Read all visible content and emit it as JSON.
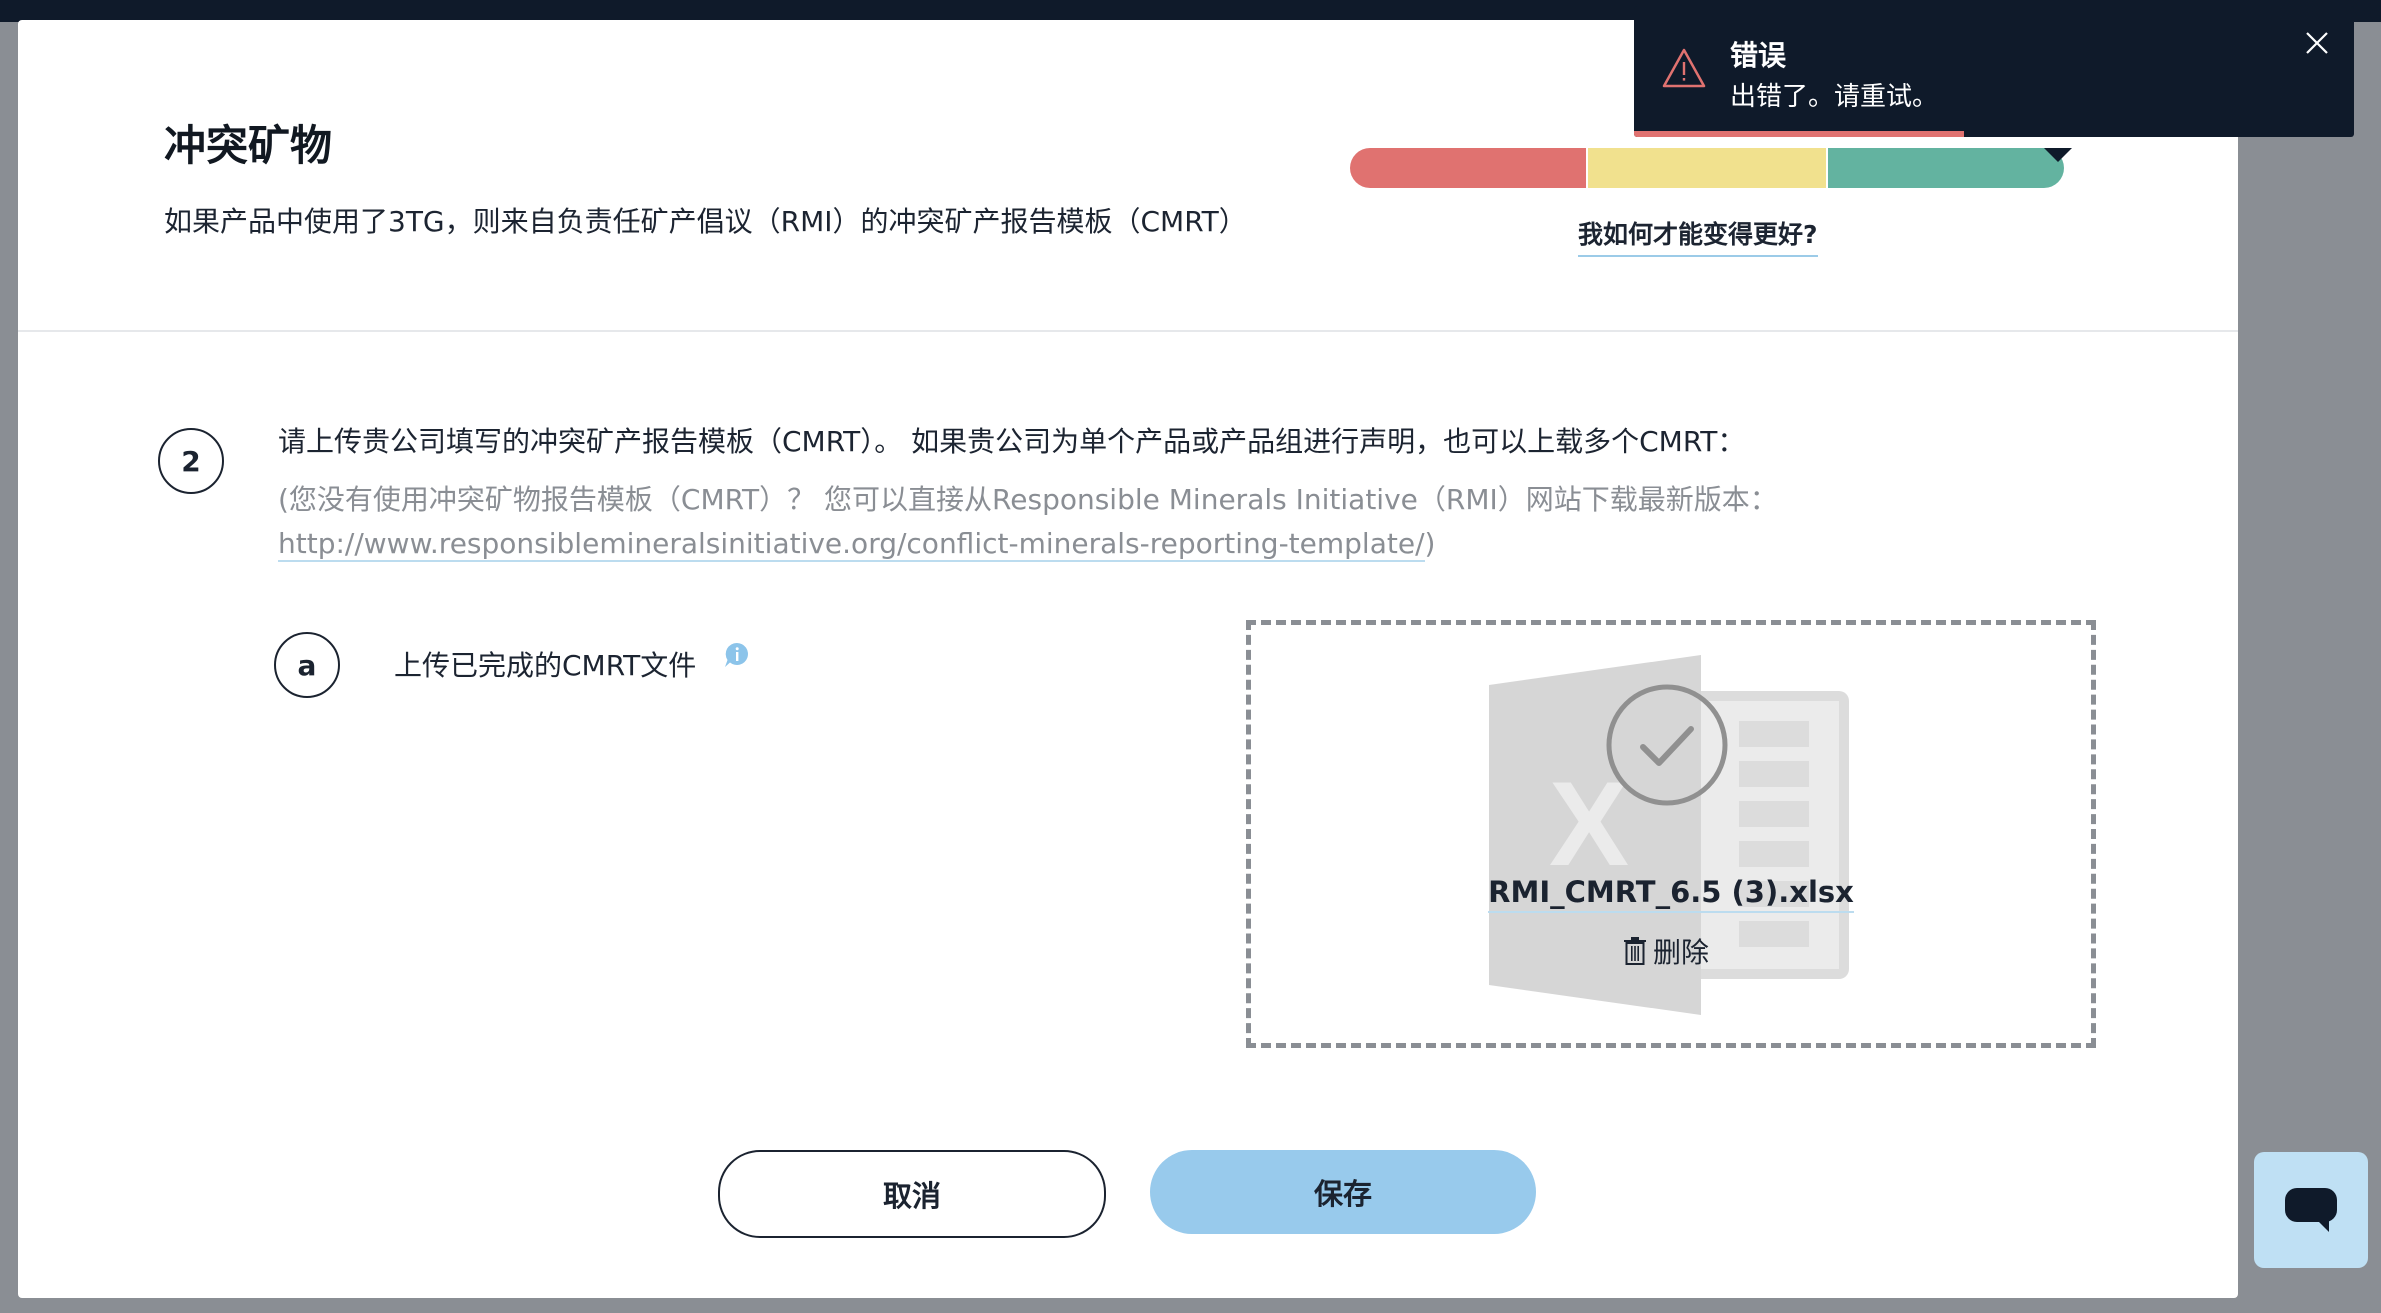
{
  "modal": {
    "title": "冲突矿物",
    "subtitle": "如果产品中使用了3TG，则来自负责任矿产倡议（RMI）的冲突矿产报告模板（CMRT）"
  },
  "score": {
    "improve_link": "我如何才能变得更好?",
    "colors": {
      "low": "#e07270",
      "mid": "#f1e18e",
      "high": "#63b3a0"
    }
  },
  "step": {
    "number": "2",
    "instruction": "请上传贵公司填写的冲突矿产报告模板（CMRT）。 如果贵公司为单个产品或产品组进行声明，也可以上载多个CMRT：",
    "hint_line1": "(您没有使用冲突矿物报告模板（CMRT）？ 您可以直接从Responsible Minerals Initiative（RMI）网站下载最新版本：",
    "hint_link": "http://www.responsiblemineralsinitiative.org/conflict-minerals-reporting-template/",
    "hint_close": ")"
  },
  "substep": {
    "letter": "a",
    "label": "上传已完成的CMRT文件",
    "info_icon": "info-icon"
  },
  "upload": {
    "file_name": "RMI_CMRT_6.5 (3).xlsx",
    "delete_label": "删除",
    "icon": "excel-file-icon"
  },
  "buttons": {
    "cancel": "取消",
    "save": "保存"
  },
  "toast": {
    "title": "错误",
    "message": "出错了。请重试。",
    "icon": "warning-icon"
  },
  "chat": {
    "icon": "chat-icon"
  }
}
